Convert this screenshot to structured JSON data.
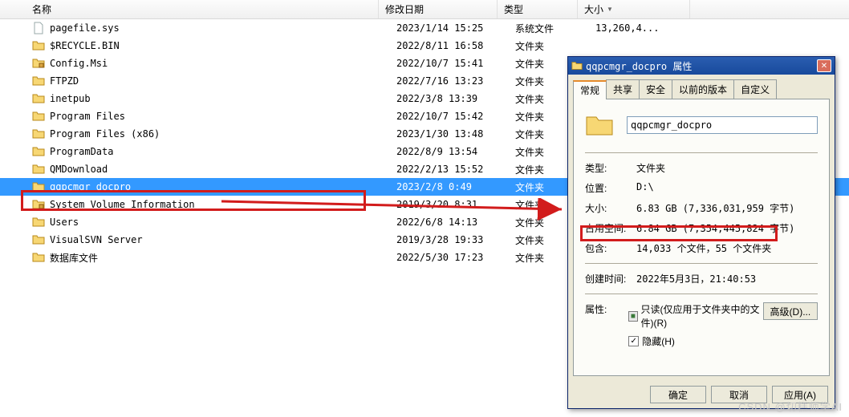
{
  "columns": {
    "name": "名称",
    "date": "修改日期",
    "type": "类型",
    "size": "大小"
  },
  "files": [
    {
      "icon": "file",
      "name": "pagefile.sys",
      "date": "2023/1/14 15:25",
      "type": "系统文件",
      "size": "13,260,4..."
    },
    {
      "icon": "folder",
      "name": "$RECYCLE.BIN",
      "date": "2022/8/11 16:58",
      "type": "文件夹",
      "size": ""
    },
    {
      "icon": "folder-lock",
      "name": "Config.Msi",
      "date": "2022/10/7 15:41",
      "type": "文件夹",
      "size": ""
    },
    {
      "icon": "folder",
      "name": "FTPZD",
      "date": "2022/7/16 13:23",
      "type": "文件夹",
      "size": ""
    },
    {
      "icon": "folder",
      "name": "inetpub",
      "date": "2022/3/8 13:39",
      "type": "文件夹",
      "size": ""
    },
    {
      "icon": "folder",
      "name": "Program Files",
      "date": "2022/10/7 15:42",
      "type": "文件夹",
      "size": ""
    },
    {
      "icon": "folder",
      "name": "Program Files (x86)",
      "date": "2023/1/30 13:48",
      "type": "文件夹",
      "size": ""
    },
    {
      "icon": "folder",
      "name": "ProgramData",
      "date": "2022/8/9 13:54",
      "type": "文件夹",
      "size": ""
    },
    {
      "icon": "folder",
      "name": "QMDownload",
      "date": "2022/2/13 15:52",
      "type": "文件夹",
      "size": ""
    },
    {
      "icon": "folder",
      "name": "qqpcmgr_docpro",
      "date": "2023/2/8 0:49",
      "type": "文件夹",
      "size": "",
      "selected": true
    },
    {
      "icon": "folder-lock",
      "name": "System Volume Information",
      "date": "2019/3/20 8:31",
      "type": "文件夹",
      "size": ""
    },
    {
      "icon": "folder",
      "name": "Users",
      "date": "2022/6/8 14:13",
      "type": "文件夹",
      "size": ""
    },
    {
      "icon": "folder",
      "name": "VisualSVN Server",
      "date": "2019/3/28 19:33",
      "type": "文件夹",
      "size": ""
    },
    {
      "icon": "folder",
      "name": "数据库文件",
      "date": "2022/5/30 17:23",
      "type": "文件夹",
      "size": ""
    }
  ],
  "dialog": {
    "title": "qqpcmgr_docpro 属性",
    "tabs": {
      "general": "常规",
      "share": "共享",
      "security": "安全",
      "prev": "以前的版本",
      "custom": "自定义"
    },
    "name_value": "qqpcmgr_docpro",
    "kv": {
      "type_k": "类型:",
      "type_v": "文件夹",
      "loc_k": "位置:",
      "loc_v": "D:\\",
      "size_k": "大小:",
      "size_v": "6.83 GB (7,336,031,959 字节)",
      "disk_k": "占用空间:",
      "disk_v": "6.84 GB (7,354,445,824 字节)",
      "contains_k": "包含:",
      "contains_v": "14,033 个文件，55 个文件夹",
      "created_k": "创建时间:",
      "created_v": "2022年5月3日，21:40:53",
      "attr_k": "属性:"
    },
    "readonly_label": "只读(仅应用于文件夹中的文件)(R)",
    "hidden_label": "隐藏(H)",
    "advanced": "高级(D)...",
    "ok": "确定",
    "cancel": "取消",
    "apply": "应用(A)"
  },
  "watermark": "CSDN @切糕师学AI"
}
